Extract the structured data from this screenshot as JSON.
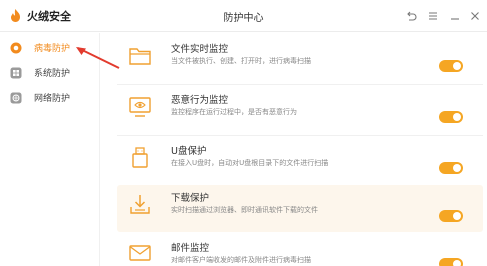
{
  "app": {
    "name": "火绒安全",
    "window_title": "防护中心"
  },
  "colors": {
    "accent": "#f5a623",
    "active_text": "#f28b1e",
    "icon_stroke": "#f0a030",
    "annotation": "#e23b2e"
  },
  "sidebar": {
    "items": [
      {
        "label": "病毒防护",
        "icon": "virus-shield-icon",
        "active": true
      },
      {
        "label": "系统防护",
        "icon": "windows-icon",
        "active": false
      },
      {
        "label": "网络防护",
        "icon": "network-icon",
        "active": false
      }
    ]
  },
  "protections": [
    {
      "title": "文件实时监控",
      "desc": "当文件被执行、创建、打开时，进行病毒扫描",
      "icon": "folder-icon",
      "enabled": true
    },
    {
      "title": "恶意行为监控",
      "desc": "监控程序在运行过程中，是否有恶意行为",
      "icon": "monitor-eye-icon",
      "enabled": true
    },
    {
      "title": "U盘保护",
      "desc": "在接入U盘时，自动对U盘根目录下的文件进行扫描",
      "icon": "usb-drive-icon",
      "enabled": true
    },
    {
      "title": "下载保护",
      "desc": "实时扫描通过浏览器、即时通讯软件下载的文件",
      "icon": "download-icon",
      "enabled": true
    },
    {
      "title": "邮件监控",
      "desc": "对邮件客户端收发的邮件及附件进行病毒扫描",
      "icon": "mail-icon",
      "enabled": true
    }
  ]
}
